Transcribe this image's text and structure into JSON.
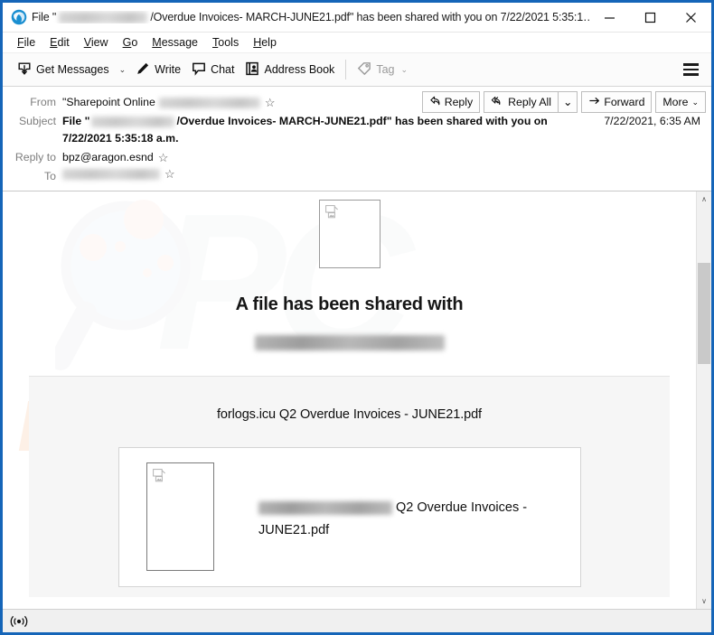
{
  "window": {
    "title_prefix": "File \"",
    "title_redacted": "[redacted-domain]",
    "title_suffix": "/Overdue Invoices- MARCH-JUNE21.pdf\" has been shared with you on 7/22/2021 5:35:1…",
    "app_icon": "thunderbird-icon",
    "controls": {
      "minimize": "–",
      "maximize": "☐",
      "close": "×"
    },
    "accent_color": "#1565b8"
  },
  "menubar": {
    "items": [
      {
        "label": "File",
        "accel": "F"
      },
      {
        "label": "Edit",
        "accel": "E"
      },
      {
        "label": "View",
        "accel": "V"
      },
      {
        "label": "Go",
        "accel": "G"
      },
      {
        "label": "Message",
        "accel": "M"
      },
      {
        "label": "Tools",
        "accel": "T"
      },
      {
        "label": "Help",
        "accel": "H"
      }
    ]
  },
  "toolbar": {
    "get_messages_label": "Get Messages",
    "get_messages_icon": "download-inbox-icon",
    "get_messages_caret": "⌄",
    "write_label": "Write",
    "write_icon": "pencil-icon",
    "chat_label": "Chat",
    "chat_icon": "speech-bubble-icon",
    "address_book_label": "Address Book",
    "address_book_icon": "address-book-icon",
    "tag_label": "Tag",
    "tag_icon": "tag-icon",
    "tag_caret": "⌄",
    "app_menu_icon": "hamburger-menu-icon"
  },
  "message_header": {
    "from_label": "From",
    "from_value": "\"Sharepoint Online",
    "from_redacted": "[redacted-address]",
    "subject_label": "Subject",
    "subject_prefix": "File \"",
    "subject_redacted": "[redacted-domain]",
    "subject_suffix": "/Overdue Invoices- MARCH-JUNE21.pdf\" has been shared with you on 7/22/2021 5:35:18 a.m.",
    "date": "7/22/2021, 6:35 AM",
    "reply_to_label": "Reply to",
    "reply_to_value": "bpz@aragon.esnd",
    "to_label": "To",
    "to_redacted": "[redacted-address]",
    "star_icon": "star-outline-icon",
    "buttons": {
      "reply_label": "Reply",
      "reply_icon": "reply-arrow-icon",
      "reply_all_label": "Reply All",
      "reply_all_icon": "reply-all-arrow-icon",
      "reply_all_caret": "⌄",
      "forward_label": "Forward",
      "forward_icon": "forward-arrow-icon",
      "more_label": "More",
      "more_caret": "⌄"
    }
  },
  "message_body": {
    "watermark_pcrisk": "PC",
    "watermark_risk": "risk.com",
    "watermark_glass_icon": "magnifying-glass-watermark-icon",
    "top_image_icon": "broken-image-icon",
    "heading": "A file has been shared with",
    "recipient_redacted": "[redacted-email]",
    "file_title": "forlogs.icu Q2 Overdue Invoices - JUNE21.pdf",
    "attachment": {
      "thumb_icon": "broken-image-icon",
      "sender_redacted": "[redacted-email]",
      "name": "Q2 Overdue Invoices - JUNE21.pdf"
    }
  },
  "scrollbar": {
    "up_arrow": "∧",
    "down_arrow": "∨"
  },
  "statusbar": {
    "online_icon": "broadcast-online-icon"
  }
}
